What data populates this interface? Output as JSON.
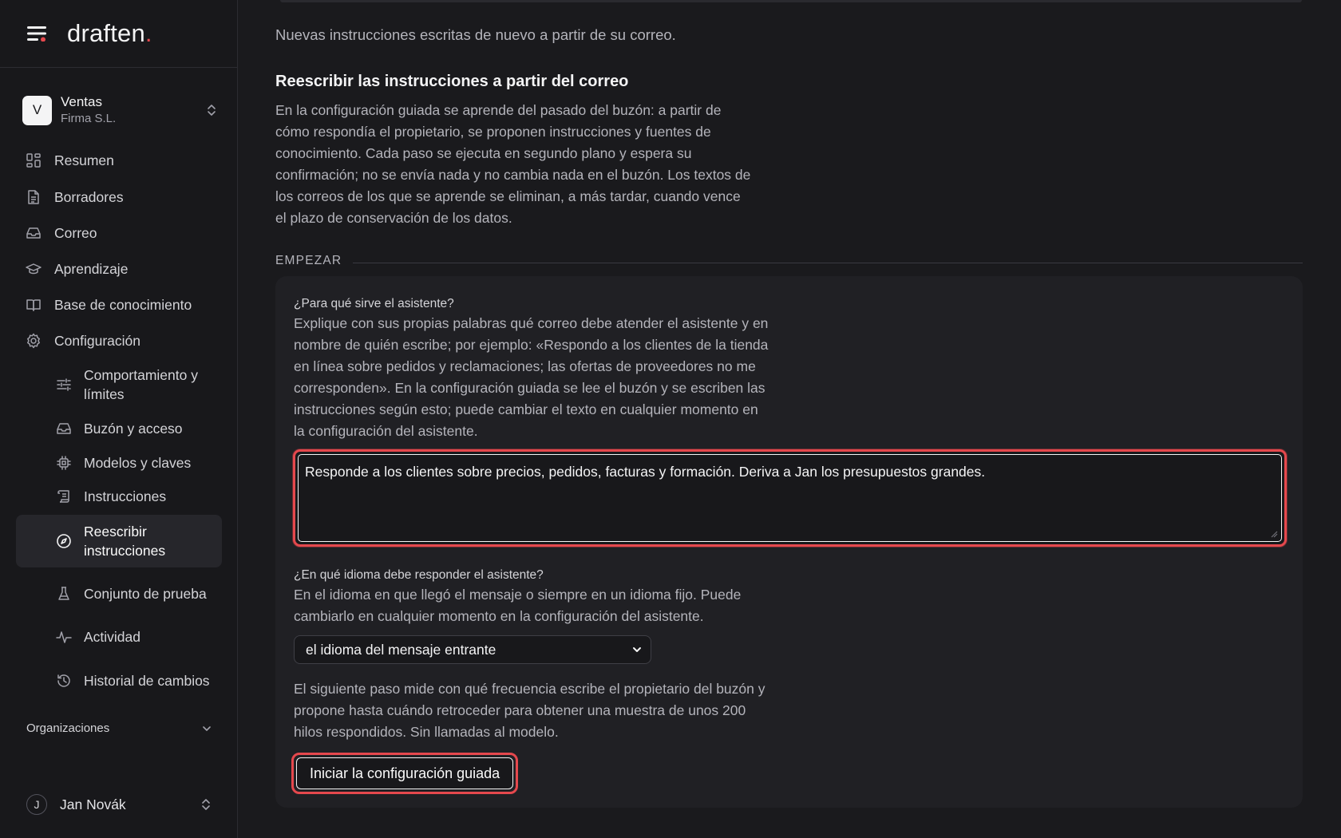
{
  "app": {
    "brand": "draften",
    "brand_dot": "."
  },
  "workspace": {
    "initial": "V",
    "name": "Ventas",
    "org": "Firma S.L."
  },
  "nav": {
    "items": [
      {
        "label": "Resumen",
        "icon": "dashboard-icon"
      },
      {
        "label": "Borradores",
        "icon": "document-icon"
      },
      {
        "label": "Correo",
        "icon": "inbox-icon"
      },
      {
        "label": "Aprendizaje",
        "icon": "graduation-cap-icon"
      },
      {
        "label": "Base de conocimiento",
        "icon": "book-icon"
      },
      {
        "label": "Configuración",
        "icon": "gear-icon"
      }
    ],
    "sub_items": [
      {
        "label": "Comportamiento y límites",
        "icon": "sliders-icon"
      },
      {
        "label": "Buzón y acceso",
        "icon": "inbox-icon"
      },
      {
        "label": "Modelos y claves",
        "icon": "chip-icon"
      },
      {
        "label": "Instrucciones",
        "icon": "scroll-icon"
      },
      {
        "label": "Reescribir instrucciones",
        "icon": "compass-icon",
        "active": true
      },
      {
        "label": "Conjunto de prueba",
        "icon": "flask-icon"
      },
      {
        "label": "Actividad",
        "icon": "activity-icon"
      },
      {
        "label": "Historial de cambios",
        "icon": "history-icon"
      }
    ],
    "organizations_label": "Organizaciones"
  },
  "user": {
    "initial": "J",
    "name": "Jan Novák"
  },
  "main": {
    "intro": "Nuevas instrucciones escritas de nuevo a partir de su correo.",
    "heading": "Reescribir las instrucciones a partir del correo",
    "description": "En la configuración guiada se aprende del pasado del buzón: a partir de cómo respondía el propietario, se proponen instrucciones y fuentes de conocimiento. Cada paso se ejecuta en segundo plano y espera su confirmación; no se envía nada y no cambia nada en el buzón. Los textos de los correos de los que se aprende se eliminan, a más tardar, cuando vence el plazo de conservación de los datos.",
    "section_label": "EMPEZAR",
    "purpose": {
      "label": "¿Para qué sirve el asistente?",
      "help": "Explique con sus propias palabras qué correo debe atender el asistente y en nombre de quién escribe; por ejemplo: «Respondo a los clientes de la tienda en línea sobre pedidos y reclamaciones; las ofertas de proveedores no me corresponden». En la configuración guiada se lee el buzón y se escriben las instrucciones según esto; puede cambiar el texto en cualquier momento en la configuración del asistente.",
      "value": "Responde a los clientes sobre precios, pedidos, facturas y formación. Deriva a Jan los presupuestos grandes."
    },
    "language": {
      "label": "¿En qué idioma debe responder el asistente?",
      "help": "En el idioma en que llegó el mensaje o siempre en un idioma fijo. Puede cambiarlo en cualquier momento en la configuración del asistente.",
      "selected": "el idioma del mensaje entrante"
    },
    "next_step": "El siguiente paso mide con qué frecuencia escribe el propietario del buzón y propone hasta cuándo retroceder para obtener una muestra de unos 200 hilos respondidos. Sin llamadas al modelo.",
    "start_button": "Iniciar la configuración guiada"
  },
  "colors": {
    "accent": "#e5484d",
    "background": "#1a1a1d",
    "sidebar": "#18181b",
    "card": "#202024"
  }
}
